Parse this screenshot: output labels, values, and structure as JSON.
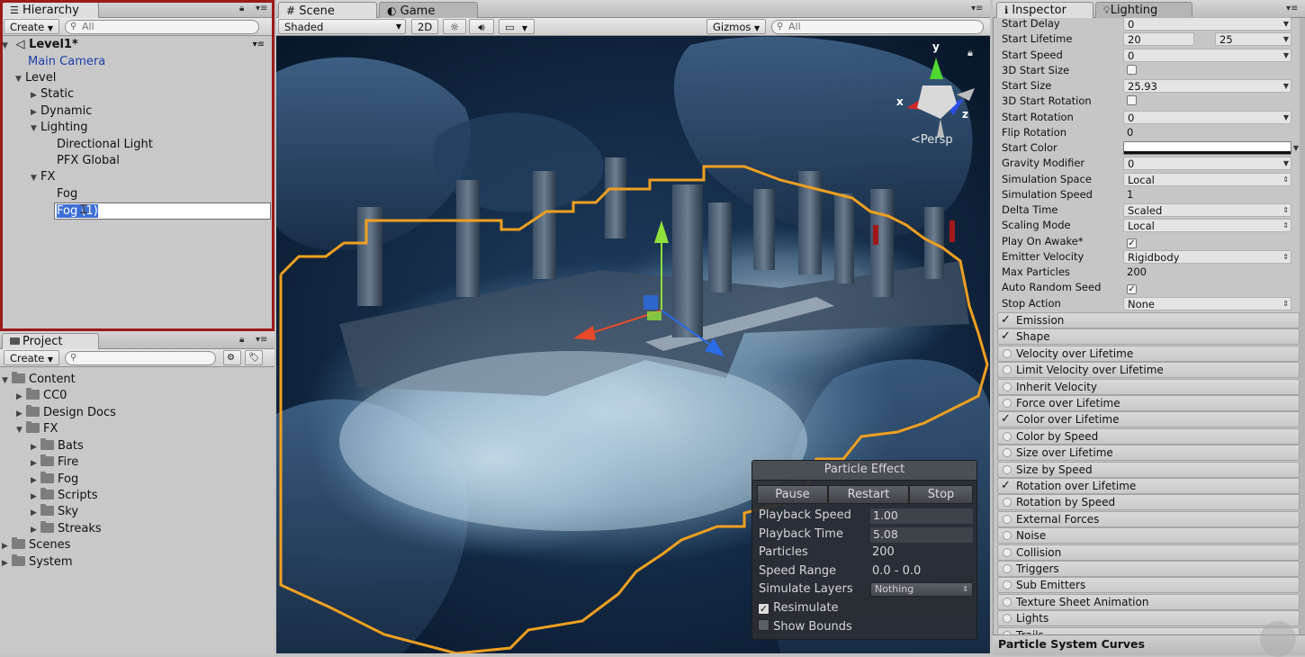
{
  "hierarchy": {
    "tab_label": "Hierarchy",
    "create_label": "Create",
    "search_placeholder": "All",
    "scene_name": "Level1*",
    "items": [
      {
        "label": "Main Camera"
      },
      {
        "label": "Level"
      },
      {
        "label": "Static"
      },
      {
        "label": "Dynamic"
      },
      {
        "label": "Lighting"
      },
      {
        "label": "Directional Light"
      },
      {
        "label": "PFX Global"
      },
      {
        "label": "FX"
      },
      {
        "label": "Fog"
      },
      {
        "label": "Fog (1)"
      }
    ],
    "rename_value": "Fog (1)"
  },
  "project": {
    "tab_label": "Project",
    "create_label": "Create",
    "items": [
      {
        "label": "Content"
      },
      {
        "label": "CC0"
      },
      {
        "label": "Design Docs"
      },
      {
        "label": "FX"
      },
      {
        "label": "Bats"
      },
      {
        "label": "Fire"
      },
      {
        "label": "Fog"
      },
      {
        "label": "Scripts"
      },
      {
        "label": "Sky"
      },
      {
        "label": "Streaks"
      },
      {
        "label": "Scenes"
      },
      {
        "label": "System"
      }
    ]
  },
  "scene": {
    "tab_scene": "Scene",
    "tab_game": "Game",
    "shading_mode": "Shaded",
    "mode_2d": "2D",
    "gizmos_label": "Gizmos",
    "search_placeholder": "All",
    "axis_y": "y",
    "axis_x": "x",
    "axis_z": "z",
    "persp_label": "Persp"
  },
  "particle_effect": {
    "title": "Particle Effect",
    "pause_label": "Pause",
    "restart_label": "Restart",
    "stop_label": "Stop",
    "playback_speed_label": "Playback Speed",
    "playback_speed": "1.00",
    "playback_time_label": "Playback Time",
    "playback_time": "5.08",
    "particles_label": "Particles",
    "particles": "200",
    "speed_range_label": "Speed Range",
    "speed_range": "0.0 - 0.0",
    "simulate_layers_label": "Simulate Layers",
    "simulate_layers": "Nothing",
    "resimulate_label": "Resimulate",
    "resimulate_checked": true,
    "show_bounds_label": "Show Bounds",
    "show_bounds_checked": false
  },
  "inspector": {
    "tab_inspector": "Inspector",
    "tab_lighting": "Lighting",
    "properties": [
      {
        "label": "Start Delay",
        "value": "0",
        "kind": "field"
      },
      {
        "label": "Start Lifetime",
        "value": "20",
        "value2": "25",
        "kind": "range"
      },
      {
        "label": "Start Speed",
        "value": "0",
        "kind": "field"
      },
      {
        "label": "3D Start Size",
        "value": "",
        "kind": "check",
        "checked": false
      },
      {
        "label": "Start Size",
        "value": "25.93",
        "kind": "field"
      },
      {
        "label": "3D Start Rotation",
        "value": "",
        "kind": "check",
        "checked": false
      },
      {
        "label": "Start Rotation",
        "value": "0",
        "kind": "field"
      },
      {
        "label": "Flip Rotation",
        "value": "0",
        "kind": "plain"
      },
      {
        "label": "Start Color",
        "value": "",
        "kind": "color"
      },
      {
        "label": "Gravity Modifier",
        "value": "0",
        "kind": "field"
      },
      {
        "label": "Simulation Space",
        "value": "Local",
        "kind": "dropdown"
      },
      {
        "label": "Simulation Speed",
        "value": "1",
        "kind": "plain"
      },
      {
        "label": "Delta Time",
        "value": "Scaled",
        "kind": "dropdown"
      },
      {
        "label": "Scaling Mode",
        "value": "Local",
        "kind": "dropdown"
      },
      {
        "label": "Play On Awake*",
        "value": "",
        "kind": "check",
        "checked": true
      },
      {
        "label": "Emitter Velocity",
        "value": "Rigidbody",
        "kind": "dropdown"
      },
      {
        "label": "Max Particles",
        "value": "200",
        "kind": "plain"
      },
      {
        "label": "Auto Random Seed",
        "value": "",
        "kind": "check",
        "checked": true
      },
      {
        "label": "Stop Action",
        "value": "None",
        "kind": "dropdown"
      }
    ],
    "modules": [
      {
        "label": "Emission",
        "enabled": true
      },
      {
        "label": "Shape",
        "enabled": true
      },
      {
        "label": "Velocity over Lifetime",
        "enabled": false
      },
      {
        "label": "Limit Velocity over Lifetime",
        "enabled": false
      },
      {
        "label": "Inherit Velocity",
        "enabled": false
      },
      {
        "label": "Force over Lifetime",
        "enabled": false
      },
      {
        "label": "Color over Lifetime",
        "enabled": true
      },
      {
        "label": "Color by Speed",
        "enabled": false
      },
      {
        "label": "Size over Lifetime",
        "enabled": false
      },
      {
        "label": "Size by Speed",
        "enabled": false
      },
      {
        "label": "Rotation over Lifetime",
        "enabled": true
      },
      {
        "label": "Rotation by Speed",
        "enabled": false
      },
      {
        "label": "External Forces",
        "enabled": false
      },
      {
        "label": "Noise",
        "enabled": false
      },
      {
        "label": "Collision",
        "enabled": false
      },
      {
        "label": "Triggers",
        "enabled": false
      },
      {
        "label": "Sub Emitters",
        "enabled": false
      },
      {
        "label": "Texture Sheet Animation",
        "enabled": false
      },
      {
        "label": "Lights",
        "enabled": false
      },
      {
        "label": "Trails",
        "enabled": false
      }
    ],
    "curves_label": "Particle System Curves"
  },
  "colors": {
    "selection_outline": "#9b1a1a",
    "bounds_outline": "#f0a020",
    "hierarchy_blue": "#1a3fa8",
    "overlay_bg": "#2a2e34"
  }
}
